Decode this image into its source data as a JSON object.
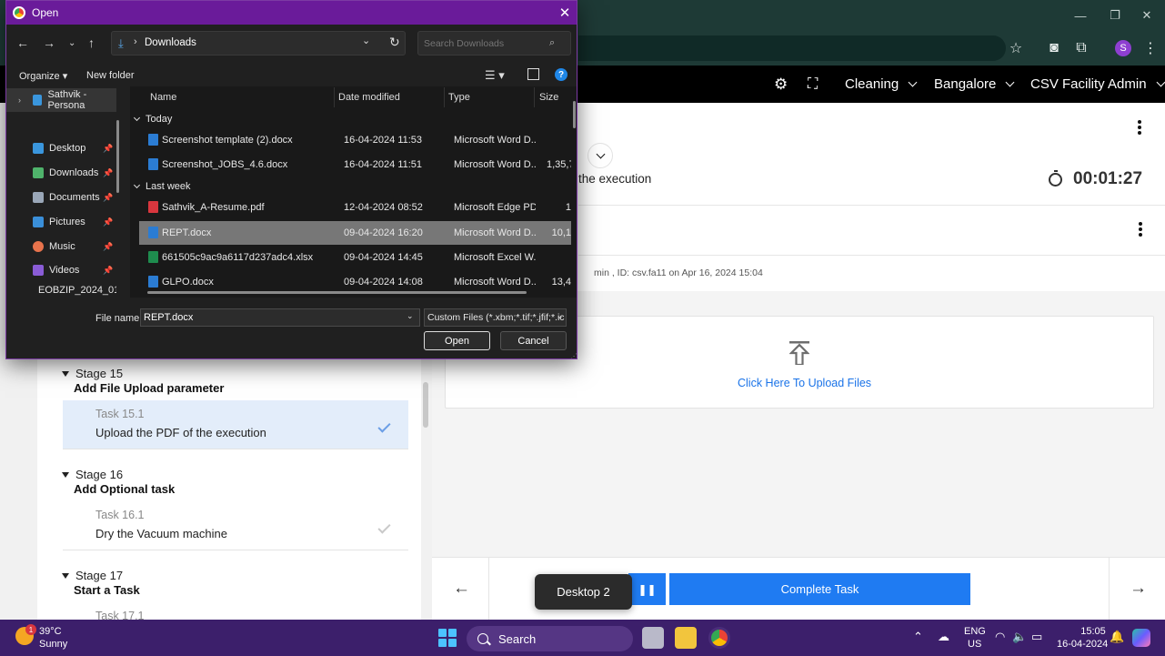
{
  "header": {
    "module": "Cleaning",
    "location": "Bangalore",
    "role": "CSV Facility Admin",
    "settings_icon": "gear-icon",
    "scan_icon": "qr-scan-icon"
  },
  "task_view": {
    "title_partial": "the execution",
    "timer": "00:01:27",
    "audit_partial": "min , ID: csv.fa11 on Apr 16, 2024 15:04",
    "upload_label": "Click Here To Upload Files"
  },
  "stages": [
    {
      "stage_label": "Stage 15",
      "stage_name": "Add File Upload parameter",
      "task_num": "Task 15.1",
      "task_name": "Upload the PDF of the execution",
      "active": true
    },
    {
      "stage_label": "Stage 16",
      "stage_name": "Add Optional task",
      "task_num": "Task 16.1",
      "task_name": "Dry the Vacuum machine",
      "active": false
    },
    {
      "stage_label": "Stage 17",
      "stage_name": "Start a Task",
      "task_num": "Task 17.1",
      "task_name": "",
      "active": false
    }
  ],
  "footer": {
    "complete_label": "Complete Task",
    "pause_glyph": "❚❚",
    "prev_glyph": "←",
    "next_glyph": "→",
    "desktop_tooltip": "Desktop 2"
  },
  "dialog": {
    "title": "Open",
    "address": "Downloads",
    "search_placeholder": "Search Downloads",
    "organize": "Organize ▾",
    "new_folder": "New folder",
    "nav_items": [
      {
        "label": "Sathvik - Persona",
        "color": "#3a96dd",
        "pin": ""
      },
      {
        "label": "Desktop",
        "color": "#3a96dd",
        "pin": "📌"
      },
      {
        "label": "Downloads",
        "color": "#4fb36b",
        "pin": "📌"
      },
      {
        "label": "Documents",
        "color": "#9aa7b8",
        "pin": "📌"
      },
      {
        "label": "Pictures",
        "color": "#3a8fd9",
        "pin": "📌"
      },
      {
        "label": "Music",
        "color": "#e8734c",
        "pin": "📌"
      },
      {
        "label": "Videos",
        "color": "#8a5cd6",
        "pin": "📌"
      },
      {
        "label": "EOBZIP_2024_01",
        "color": "#e8b93a",
        "pin": ""
      }
    ],
    "columns": {
      "name": "Name",
      "date": "Date modified",
      "type": "Type",
      "size": "Size"
    },
    "groups": [
      "Today",
      "Last week"
    ],
    "files": [
      {
        "name": "Screenshot template (2).docx",
        "date": "16-04-2024 11:53",
        "type": "Microsoft Word D...",
        "size": "",
        "color": "#2b7cd3"
      },
      {
        "name": "Screenshot_JOBS_4.6.docx",
        "date": "16-04-2024 11:51",
        "type": "Microsoft Word D...",
        "size": "1,35,7",
        "color": "#2b7cd3"
      },
      {
        "name": "Sathvik_A-Resume.pdf",
        "date": "12-04-2024 08:52",
        "type": "Microsoft Edge PD...",
        "size": "1",
        "color": "#d9363e"
      },
      {
        "name": "REPT.docx",
        "date": "09-04-2024 16:20",
        "type": "Microsoft Word D...",
        "size": "10,1",
        "color": "#2b7cd3"
      },
      {
        "name": "661505c9ac9a6117d237adc4.xlsx",
        "date": "09-04-2024 14:45",
        "type": "Microsoft Excel W...",
        "size": "",
        "color": "#1e8c4e"
      },
      {
        "name": "GLPO.docx",
        "date": "09-04-2024 14:08",
        "type": "Microsoft Word D...",
        "size": "13,4",
        "color": "#2b7cd3"
      }
    ],
    "file_name_label": "File name:",
    "file_name_value": "REPT.docx",
    "filter": "Custom Files (*.xbm;*.tif;*.jfif;*.ic",
    "open_label": "Open",
    "cancel_label": "Cancel"
  },
  "taskbar": {
    "weather_temp": "39°C",
    "weather_desc": "Sunny",
    "weather_badge": "1",
    "search_label": "Search",
    "lang_line1": "ENG",
    "lang_line2": "US",
    "time": "15:05",
    "date": "16-04-2024"
  },
  "browser": {
    "profile_initial": "S"
  }
}
